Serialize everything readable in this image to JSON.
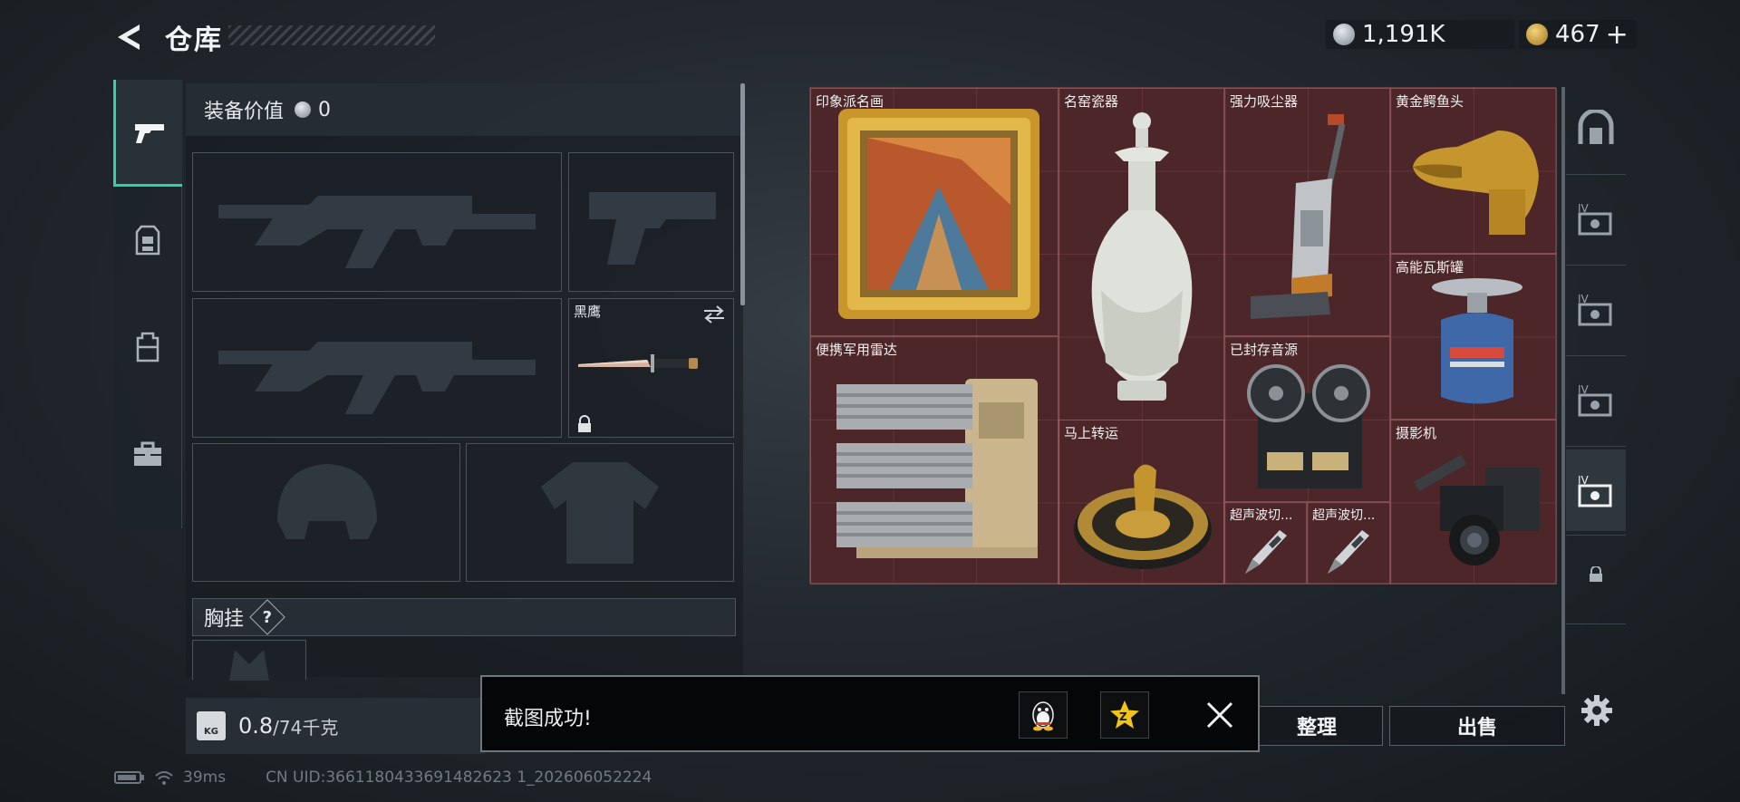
{
  "header": {
    "title": "仓库",
    "currency_silver": "1,191K",
    "currency_gold": "467",
    "add_label": "+"
  },
  "loadout": {
    "value_label": "装备价值",
    "value": "0",
    "knife_label": "黑鹰",
    "chest_label": "胸挂",
    "help_label": "?",
    "weight_current": "0.8",
    "weight_max": "/74千克",
    "weight_icon_text": "KG"
  },
  "items": [
    {
      "name": "印象派名画"
    },
    {
      "name": "名窑瓷器"
    },
    {
      "name": "强力吸尘器"
    },
    {
      "name": "黄金鳄鱼头"
    },
    {
      "name": "高能瓦斯罐"
    },
    {
      "name": "便携军用雷达"
    },
    {
      "name": "已封存音源"
    },
    {
      "name": "马上转运"
    },
    {
      "name": "摄影机"
    },
    {
      "name": "超声波切..."
    },
    {
      "name": "超声波切..."
    }
  ],
  "buttons": {
    "sort": "整理",
    "sell": "出售"
  },
  "toast": {
    "message": "截图成功!"
  },
  "status": {
    "ping": "39ms",
    "uid": "CN UID:3661180433691482623 1_202606052224"
  },
  "colors": {
    "accent_green": "#2fd3a0",
    "grid_bg": "#4c2629",
    "panel_bg": "#1c2228"
  }
}
